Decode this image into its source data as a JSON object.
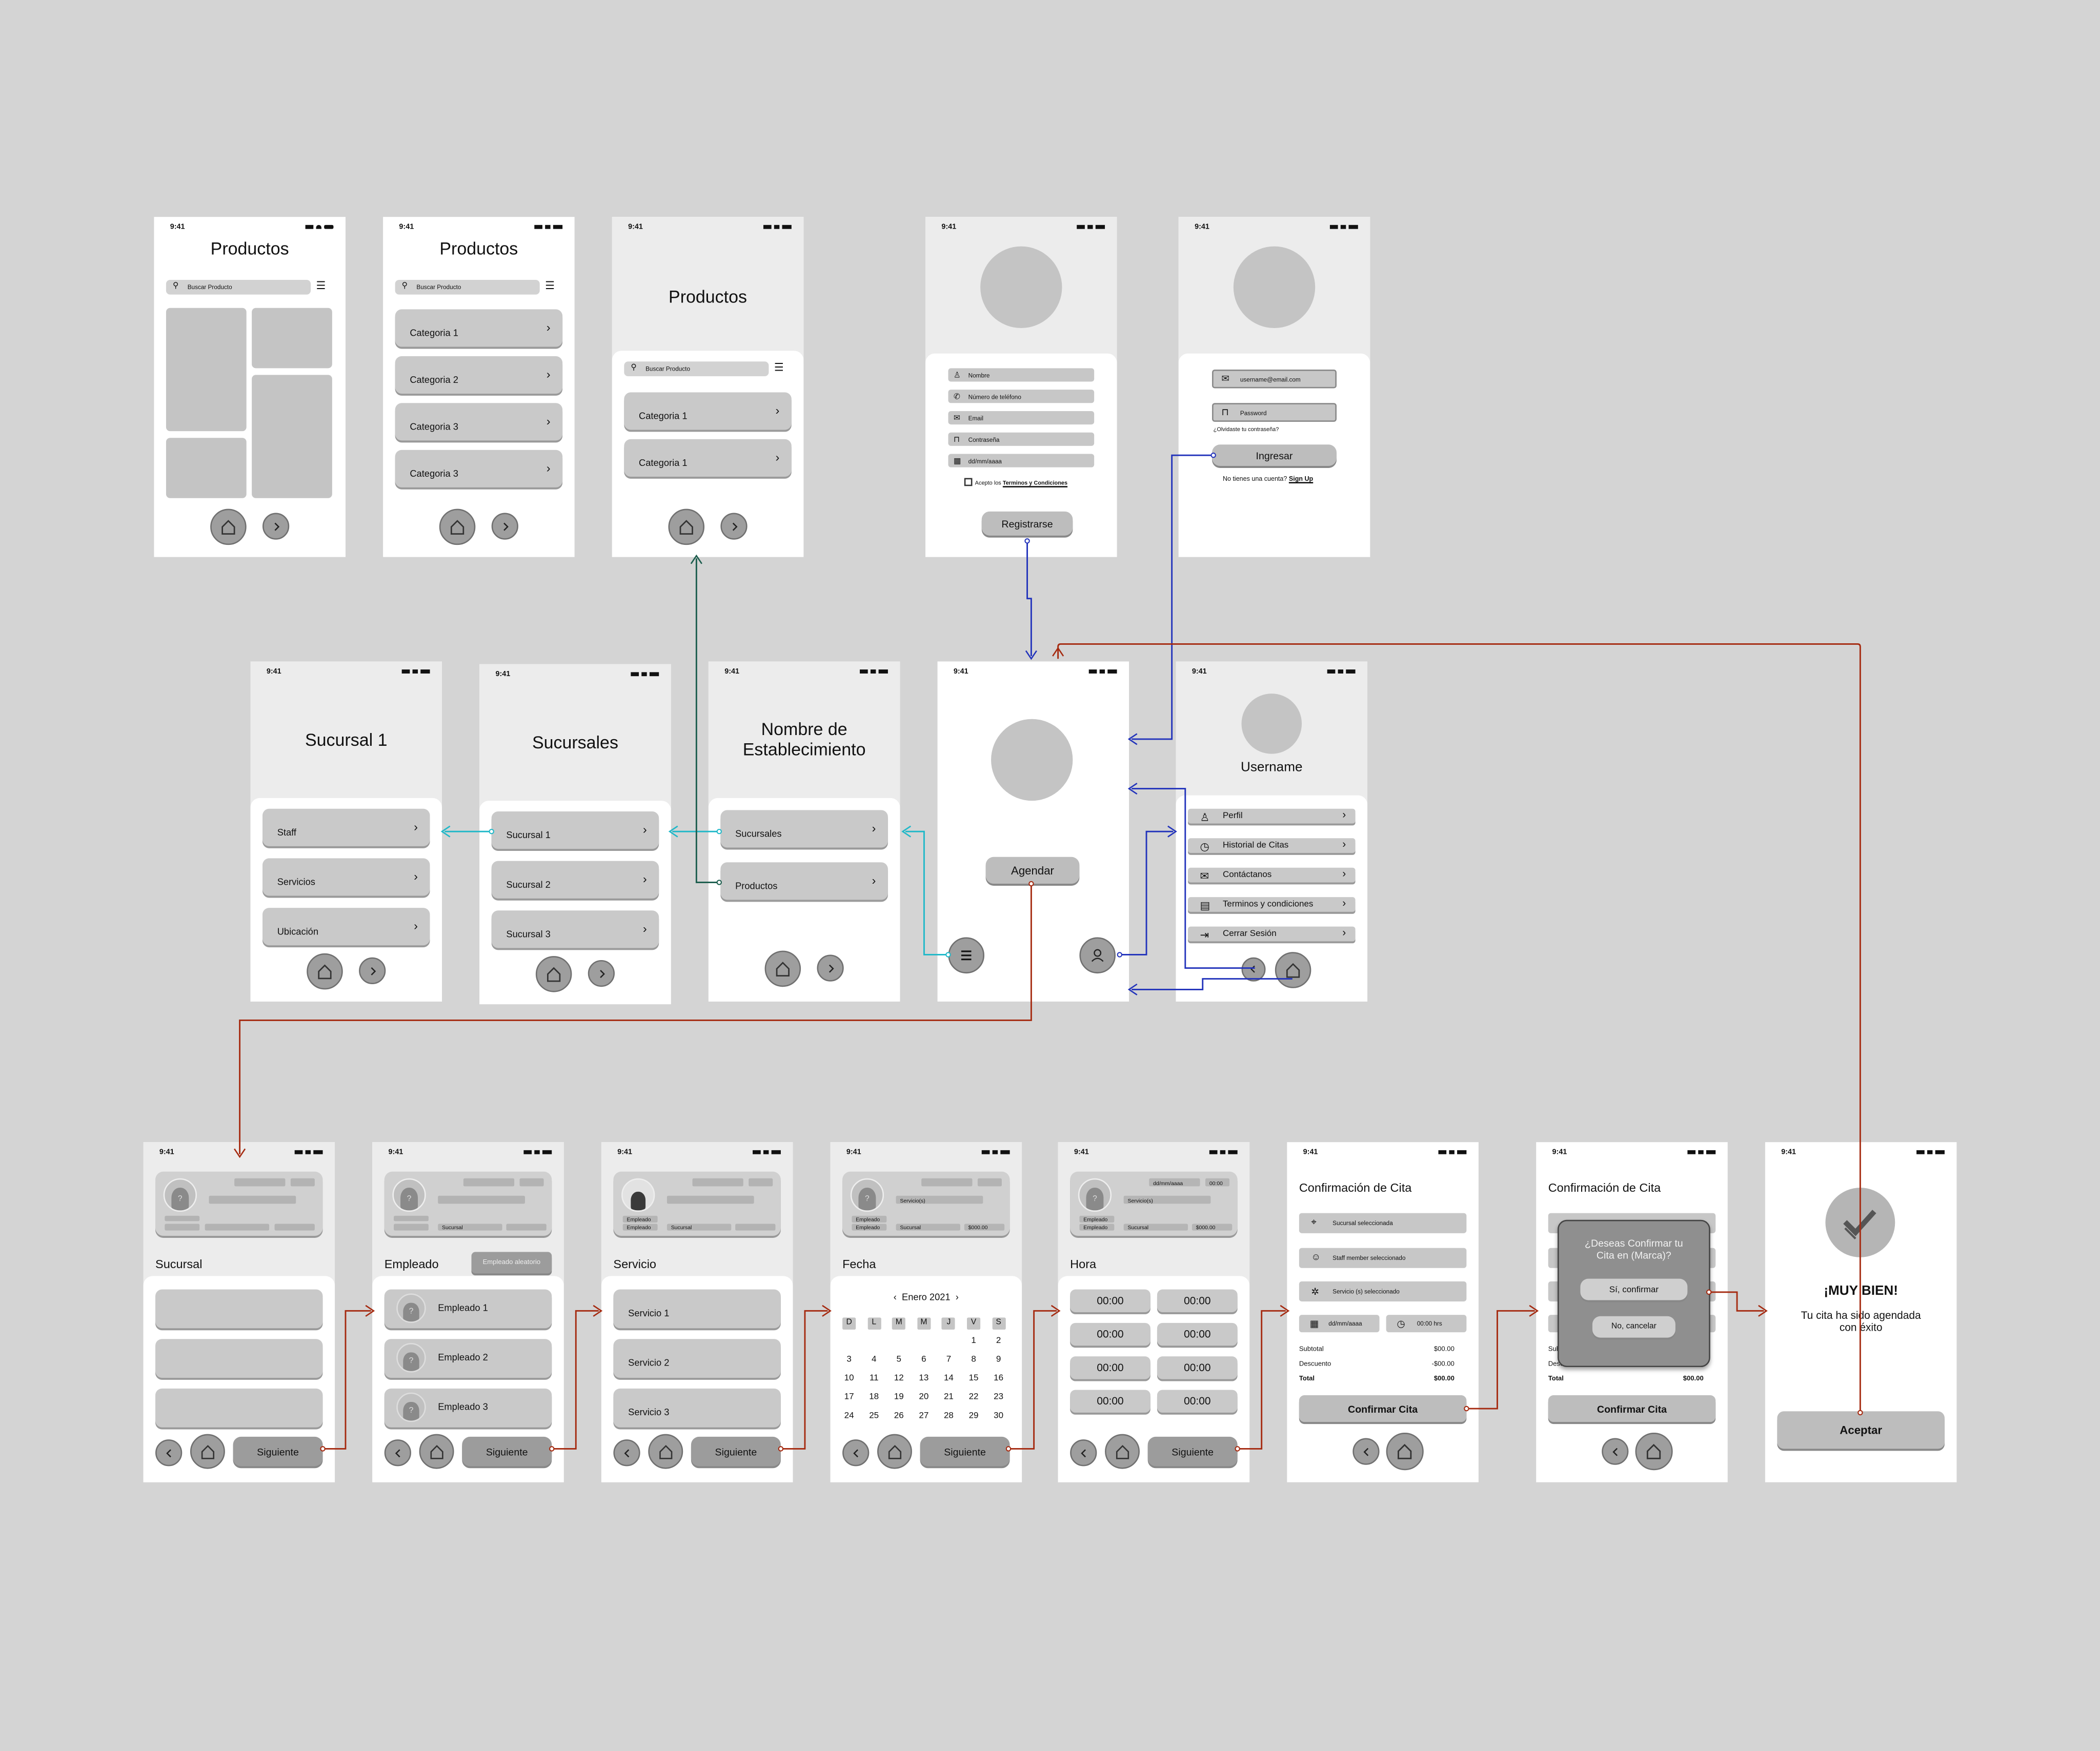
{
  "time": "9:41",
  "productos": {
    "title": "Productos",
    "search": "Buscar Producto",
    "categories": [
      "Categoria 1",
      "Categoria 2",
      "Categoria 3",
      "Categoria 3"
    ],
    "cat1": "Categoria 1"
  },
  "registro": {
    "fields": [
      "Nombre",
      "Número de teléfono",
      "Email",
      "Contraseña",
      "dd/mm/aaaa"
    ],
    "terms_prefix": "Acepto los",
    "terms_link": "Terminos y Condiciones",
    "button": "Registrarse"
  },
  "login": {
    "email": "username@email.com",
    "password": "Password",
    "forgot": "¿Olvidaste tu contraseña?",
    "button": "Ingresar",
    "no_account": "No tienes una cuenta?",
    "signup": "Sign Up"
  },
  "sucursal1": {
    "title": "Sucursal 1",
    "items": [
      "Staff",
      "Servicios",
      "Ubicación"
    ]
  },
  "sucursales": {
    "title": "Sucursales",
    "items": [
      "Sucursal 1",
      "Sucursal 2",
      "Sucursal 3"
    ]
  },
  "establecimiento": {
    "title_line1": "Nombre de",
    "title_line2": "Establecimiento",
    "items": [
      "Sucursales",
      "Productos"
    ]
  },
  "home": {
    "button": "Agendar"
  },
  "perfil": {
    "username": "Username",
    "items": [
      "Perfil",
      "Historial de Citas",
      "Contáctanos",
      "Terminos y condiciones",
      "Cerrar Sesión"
    ]
  },
  "flow": {
    "next": "Siguiente",
    "sucursal": "Sucursal",
    "empleado": "Empleado",
    "empleado_random": "Empleado aleatorio",
    "empleados": [
      "Empleado 1",
      "Empleado 2",
      "Empleado 3"
    ],
    "servicio": "Servicio",
    "servicios": [
      "Servicio 1",
      "Servicio 2",
      "Servicio 3"
    ],
    "fecha": "Fecha",
    "hora": "Hora",
    "card_empleado": "Empleado",
    "card_sucursal": "Sucursal",
    "card_servicio": "Servicio(s)",
    "card_precio": "$000.00",
    "card_fecha": "dd/mm/aaaa",
    "card_hora": "00:00"
  },
  "calendar": {
    "month": "Enero 2021",
    "days": [
      "D",
      "L",
      "M",
      "M",
      "J",
      "V",
      "S"
    ],
    "weeks": [
      [
        "",
        "",
        "",
        "",
        "",
        "1",
        "2"
      ],
      [
        "3",
        "4",
        "5",
        "6",
        "7",
        "8",
        "9"
      ],
      [
        "10",
        "11",
        "12",
        "13",
        "14",
        "15",
        "16"
      ],
      [
        "17",
        "18",
        "19",
        "20",
        "21",
        "22",
        "23"
      ],
      [
        "24",
        "25",
        "26",
        "27",
        "28",
        "29",
        "30"
      ]
    ]
  },
  "hours": [
    "00:00",
    "00:00",
    "00:00",
    "00:00",
    "00:00",
    "00:00",
    "00:00",
    "00:00"
  ],
  "confirm": {
    "title": "Confirmación de Cita",
    "sucursal": "Sucursal seleccionada",
    "staff": "Staff member seleccionado",
    "servicio": "Servicio (s) seleccionado",
    "fecha": "dd/mm/aaaa",
    "hora": "00:00 hrs",
    "subtotal_label": "Subtotal",
    "subtotal": "$00.00",
    "descuento_label": "Descuento",
    "descuento": "-$00.00",
    "total_label": "Total",
    "total": "$00.00",
    "button": "Confirmar Cita",
    "descuento2": "$00.00"
  },
  "dialog": {
    "question": "¿Deseas Confirmar tu Cita en (Marca)?",
    "yes": "Sí, confirmar",
    "no": "No, cancelar"
  },
  "success": {
    "title": "¡MUY BIEN!",
    "message": "Tu cita ha sido agendada con éxito",
    "button": "Aceptar"
  },
  "colors": {
    "background": "#d4d4d4",
    "screen": "#ffffff",
    "header": "#ececec",
    "blue_link": "#2233bb",
    "teal_link": "#1fb8c8",
    "green_link": "#1a5c4c",
    "red_link": "#a52a10"
  }
}
